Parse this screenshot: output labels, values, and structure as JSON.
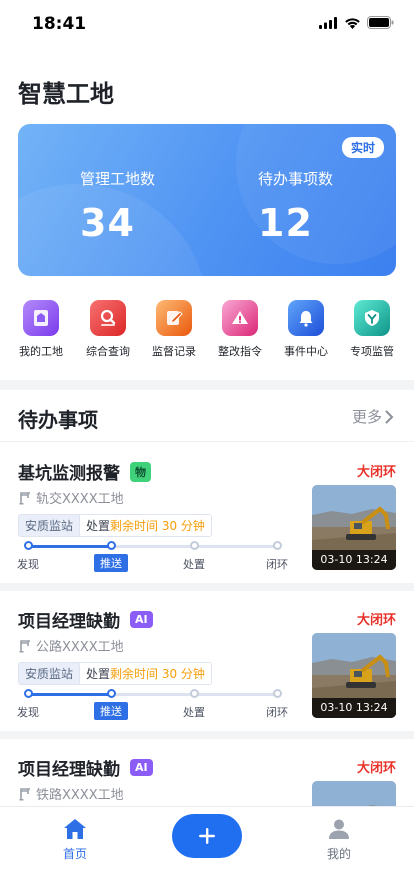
{
  "status_bar": {
    "time": "18:41"
  },
  "page": {
    "title": "智慧工地"
  },
  "hero": {
    "badge": "实时",
    "managed_label": "管理工地数",
    "managed_value": "34",
    "todo_label": "待办事项数",
    "todo_value": "12",
    "colors": {
      "start": "#73b3f7",
      "end": "#3c80f0"
    }
  },
  "quick_actions": [
    {
      "label": "我的工地",
      "icon": "my-site-icon",
      "color": "#8b5cf6"
    },
    {
      "label": "综合查询",
      "icon": "search-icon",
      "color": "#ef4444"
    },
    {
      "label": "监督记录",
      "icon": "record-icon",
      "color": "#f97316"
    },
    {
      "label": "整改指令",
      "icon": "warning-icon",
      "color": "#ec4899"
    },
    {
      "label": "事件中心",
      "icon": "bell-icon",
      "color": "#3b82f6"
    },
    {
      "label": "专项监管",
      "icon": "shield-icon",
      "color": "#14b8a6"
    }
  ],
  "todo_section": {
    "title": "待办事项",
    "more": "更多"
  },
  "todos": [
    {
      "title": "基坑监测报警",
      "tag": "物",
      "status": "大闭环",
      "site": "轨交XXXX工地",
      "station": "安质监站",
      "time_prefix": "处置",
      "time_value": "剩余时间 30 分钟",
      "steps": [
        "发现",
        "推送",
        "处置",
        "闭环"
      ],
      "current_step": "推送",
      "photo_time": "03-10 13:24"
    },
    {
      "title": "项目经理缺勤",
      "tag": "AI",
      "status": "大闭环",
      "site": "公路XXXX工地",
      "station": "安质监站",
      "time_prefix": "处置",
      "time_value": "剩余时间 30 分钟",
      "steps": [
        "发现",
        "推送",
        "处置",
        "闭环"
      ],
      "current_step": "推送",
      "photo_time": "03-10 13:24"
    },
    {
      "title": "项目经理缺勤",
      "tag": "AI",
      "status": "大闭环",
      "site": "铁路XXXX工地"
    }
  ],
  "tabbar": {
    "home": "首页",
    "me": "我的"
  },
  "accent": "#2f6fe6",
  "alert_color": "#e8332a"
}
